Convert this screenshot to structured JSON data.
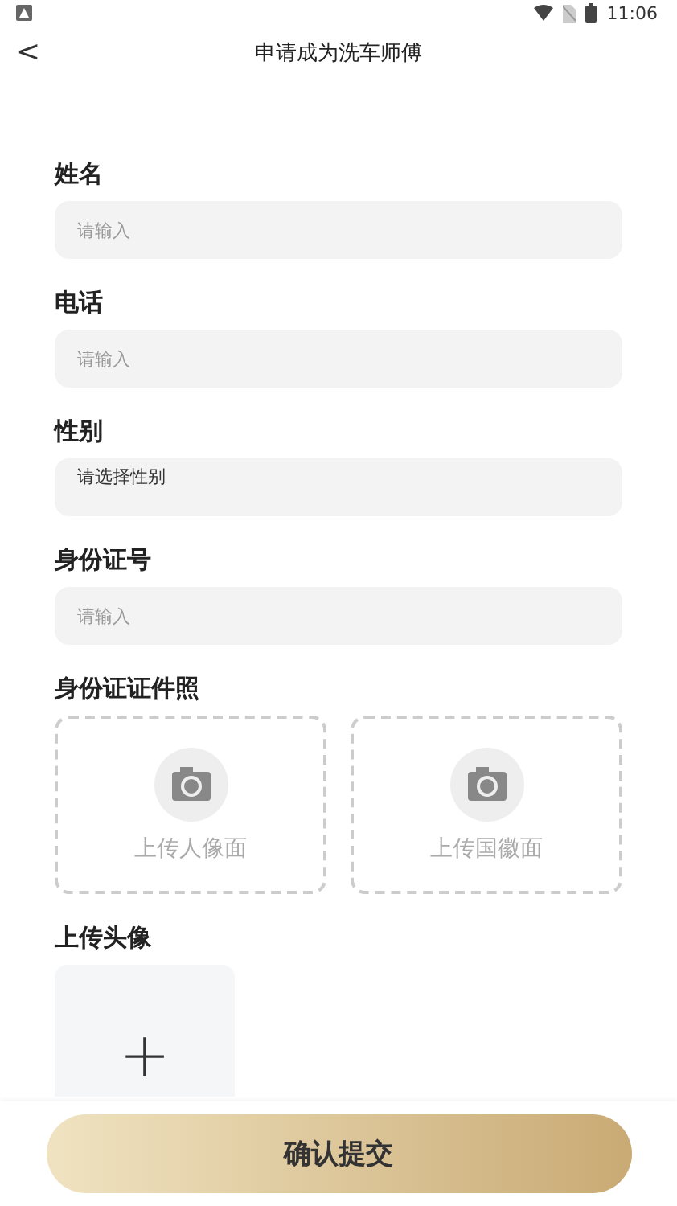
{
  "status_bar": {
    "time": "11:06"
  },
  "header": {
    "back": "<",
    "title": "申请成为洗车师傅"
  },
  "fields": [
    {
      "label": "姓名",
      "kind": "input",
      "placeholder": "请输入"
    },
    {
      "label": "电话",
      "kind": "input",
      "placeholder": "请输入"
    },
    {
      "label": "性别",
      "kind": "select",
      "placeholder": "请选择性别"
    },
    {
      "label": "身份证号",
      "kind": "input",
      "placeholder": "请输入"
    }
  ],
  "id_photos": {
    "label": "身份证证件照",
    "uploads": [
      "上传人像面",
      "上传国徽面"
    ]
  },
  "avatar": {
    "label": "上传头像",
    "add": "+"
  },
  "submit": "确认提交"
}
